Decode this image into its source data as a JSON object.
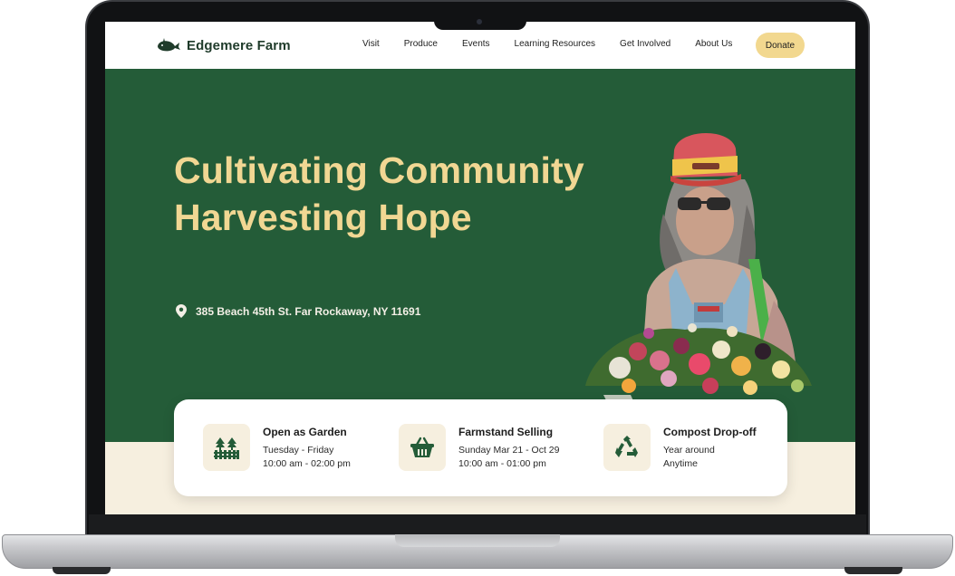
{
  "header": {
    "brand_name": "Edgemere Farm",
    "brand_icon": "whale-logo",
    "nav": [
      "Visit",
      "Produce",
      "Events",
      "Learning Resources",
      "Get Involved",
      "About Us"
    ],
    "donate_label": "Donate"
  },
  "hero": {
    "headline_line1": "Cultivating Community",
    "headline_line2": "Harvesting Hope",
    "address": "385 Beach 45th St. Far Rockaway,  NY 11691",
    "address_icon": "map-pin-icon"
  },
  "info": [
    {
      "icon": "garden-fence-icon",
      "title": "Open as Garden",
      "line1": "Tuesday - Friday",
      "line2": "10:00 am - 02:00 pm"
    },
    {
      "icon": "basket-icon",
      "title": "Farmstand Selling",
      "line1": "Sunday  Mar 21 - Oct 29",
      "line2": "10:00 am - 01:00 pm"
    },
    {
      "icon": "recycle-icon",
      "title": "Compost Drop-off",
      "line1": "Year around",
      "line2": "Anytime"
    }
  ],
  "colors": {
    "hero_green": "#245c38",
    "headline_gold": "#f1d793",
    "cream": "#f6efdf",
    "donate_bg": "#f2d88f",
    "brand_dark": "#1f3b2a"
  }
}
